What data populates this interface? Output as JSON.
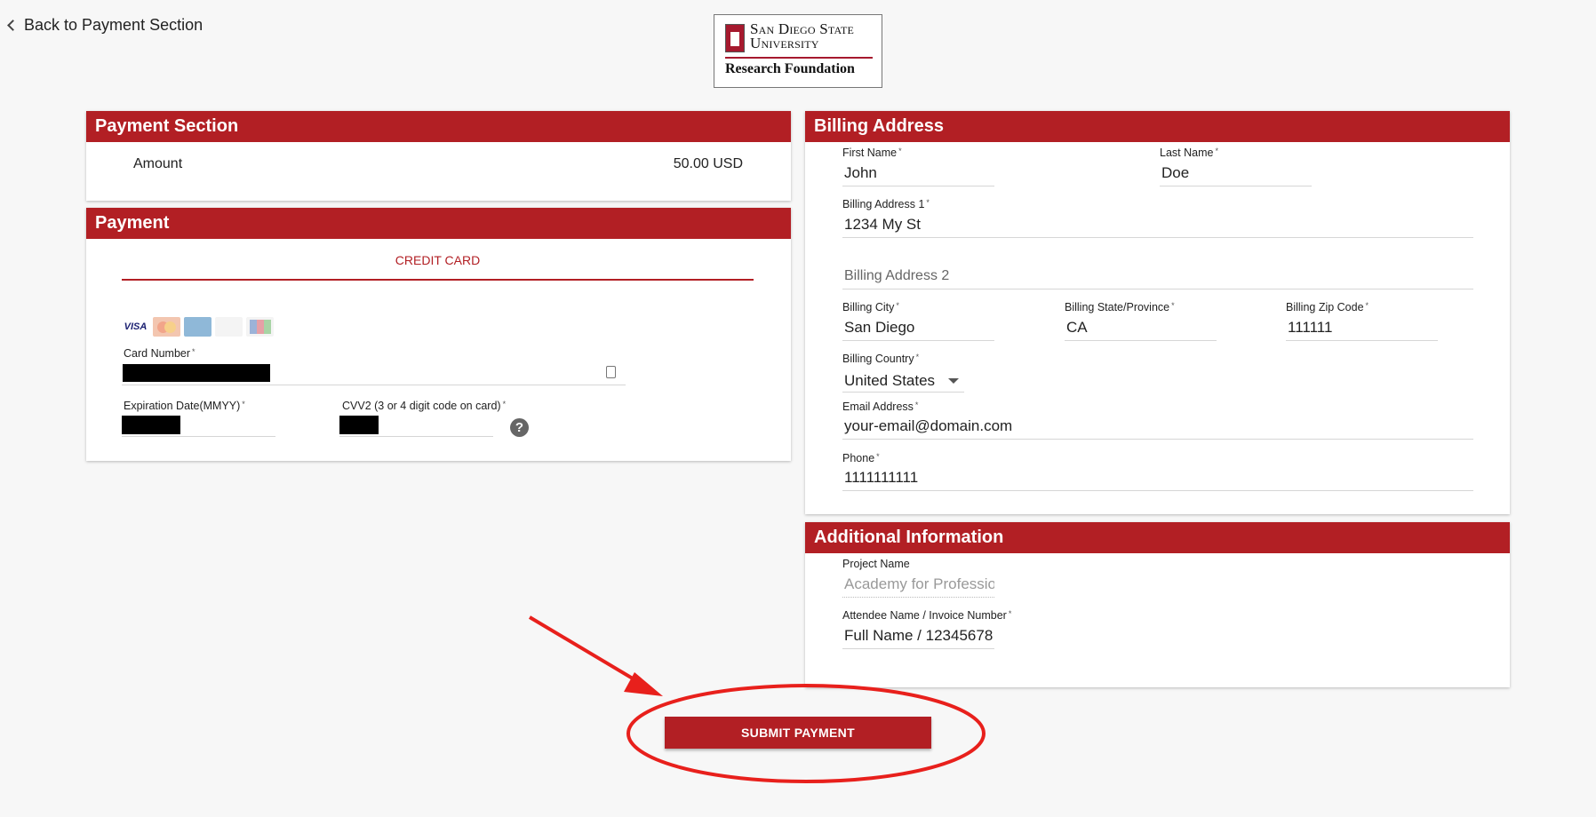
{
  "nav": {
    "back_label": "Back to Payment Section"
  },
  "logo": {
    "line1": "San Diego State",
    "line2": "University",
    "line3": "Research Foundation"
  },
  "payment_section": {
    "title": "Payment Section",
    "amount_label": "Amount",
    "amount_value": "50.00 USD"
  },
  "payment": {
    "title": "Payment",
    "tab_label": "CREDIT CARD",
    "card_brands": [
      "VISA",
      "MasterCard",
      "AmEx",
      "Discover",
      "JCB"
    ],
    "card_number_label": "Card Number",
    "expiration_label": "Expiration Date(MMYY)",
    "cvv_label": "CVV2 (3 or 4 digit code on card)",
    "help_symbol": "?"
  },
  "billing": {
    "title": "Billing Address",
    "first_name_label": "First Name",
    "first_name_value": "John",
    "last_name_label": "Last Name",
    "last_name_value": "Doe",
    "address1_label": "Billing Address 1",
    "address1_value": "1234 My St",
    "address2_placeholder": "Billing Address 2",
    "city_label": "Billing City",
    "city_value": "San Diego",
    "state_label": "Billing State/Province",
    "state_value": "CA",
    "zip_label": "Billing Zip Code",
    "zip_value": "111111",
    "country_label": "Billing Country",
    "country_value": "United States",
    "email_label": "Email Address",
    "email_value": "your-email@domain.com",
    "phone_label": "Phone",
    "phone_value": "1111111111"
  },
  "additional": {
    "title": "Additional Information",
    "project_label": "Project Name",
    "project_value": "Academy for Professior",
    "attendee_label": "Attendee Name / Invoice Number",
    "attendee_value": "Full Name / 12345678"
  },
  "submit_label": "SUBMIT PAYMENT",
  "required_mark": "*",
  "colors": {
    "brand_red": "#b21f24",
    "annotation_red": "#e8201c"
  }
}
